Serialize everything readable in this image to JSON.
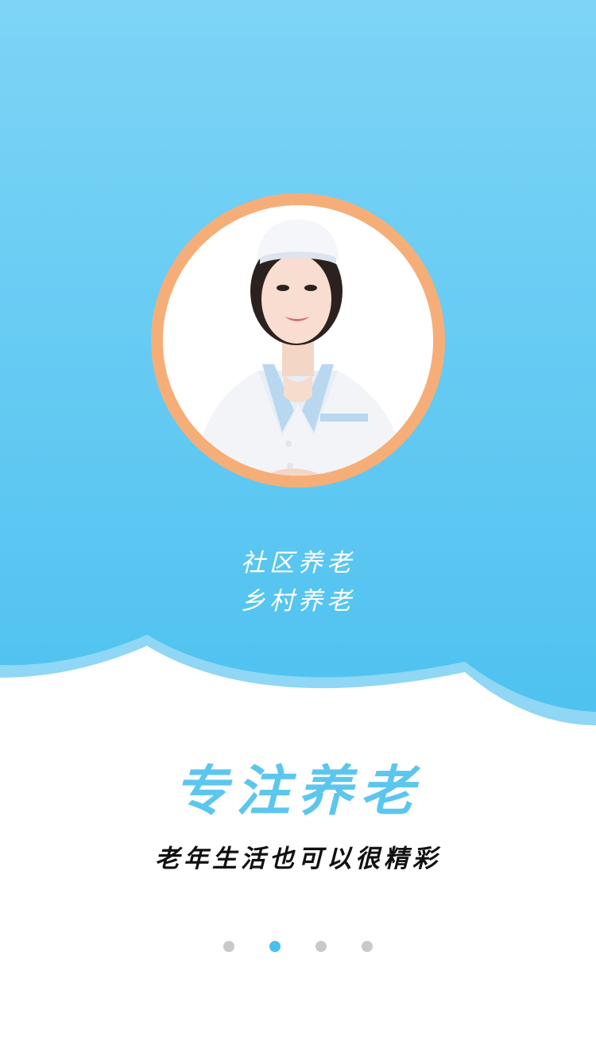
{
  "hero": {
    "line1": "社区养老",
    "line2": "乡村养老",
    "image": "nurse-portrait",
    "ring_color": "#f6ae78",
    "bg_top": "#7dd4f6",
    "bg_bottom": "#4fc2f0"
  },
  "content": {
    "title": "专注养老",
    "subtitle": "老年生活也可以很精彩",
    "title_color": "#5cc6ee"
  },
  "pager": {
    "count": 4,
    "active_index": 1,
    "active_color": "#48bfef",
    "inactive_color": "#c9c9c9"
  }
}
